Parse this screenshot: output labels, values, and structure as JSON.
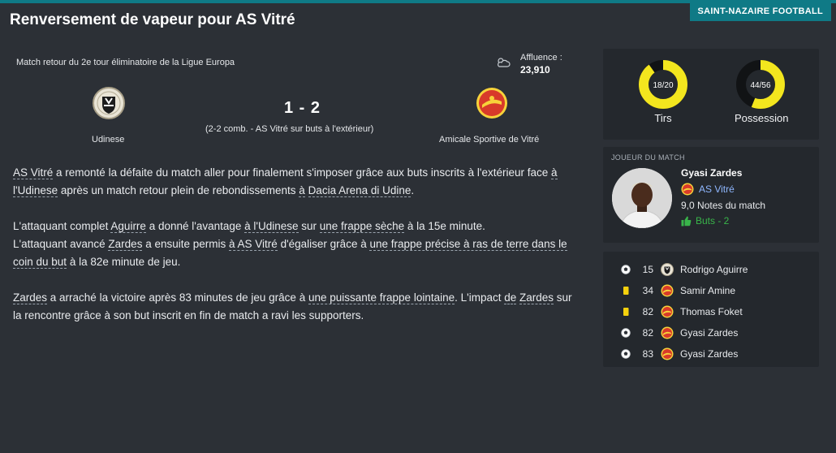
{
  "header": {
    "title": "Renversement de vapeur pour AS Vitré",
    "club_tag": "SAINT-NAZAIRE FOOTBALL"
  },
  "match": {
    "competition": "Match retour du 2e tour éliminatoire de la Ligue Europa",
    "weather_icon": "cloud-sun-icon",
    "attendance_label": "Affluence :",
    "attendance_value": "23,910",
    "home_team": "Udinese",
    "away_team": "Amicale Sportive de Vitré",
    "score": "1 - 2",
    "aggregate": "(2-2 comb. - AS Vitré sur buts à l'extérieur)"
  },
  "report": {
    "p1": [
      "AS Vitré",
      " a remonté la défaite du match aller pour finalement s'imposer grâce aux buts inscrits à l'extérieur face ",
      "à l'Udinese",
      " après un match retour plein de rebondissements ",
      "à",
      " ",
      "Dacia Arena di Udine",
      "."
    ],
    "p2": [
      "L'attaquant complet ",
      "Aguirre",
      " a donné l'avantage ",
      "à l'Udinese",
      " sur ",
      "une frappe sèche",
      " à la 15e minute."
    ],
    "p3": [
      "L'attaquant avancé ",
      "Zardes",
      " a ensuite permis ",
      "à AS Vitré",
      " d'égaliser grâce à ",
      "une frappe précise à ras de terre dans le coin du but",
      " à la 82e minute de jeu."
    ],
    "p4": [
      "Zardes",
      " a arraché la victoire après 83 minutes de jeu grâce à ",
      "une puissante frappe lointaine",
      ". L'impact ",
      "de",
      " ",
      "Zardes",
      " sur la rencontre grâce à son but inscrit en fin de match a ravi les supporters."
    ]
  },
  "stats": [
    {
      "label": "Tirs",
      "value_text": "18/20",
      "fraction": 0.9,
      "color": "#f3e61e"
    },
    {
      "label": "Possession",
      "value_text": "44/56",
      "fraction": 0.56,
      "color": "#f3e61e"
    }
  ],
  "potm": {
    "header": "JOUEUR DU MATCH",
    "name": "Gyasi Zardes",
    "club": "AS Vitré",
    "rating": "9,0",
    "rating_label": "Notes du match",
    "goals": "Buts - 2"
  },
  "events": [
    {
      "icon": "ball-icon",
      "minute": "15",
      "crest": "udinese",
      "player": "Rodrigo Aguirre"
    },
    {
      "icon": "yellow-card-icon",
      "minute": "34",
      "crest": "vitre",
      "player": "Samir Amine"
    },
    {
      "icon": "yellow-card-icon",
      "minute": "82",
      "crest": "vitre",
      "player": "Thomas Foket"
    },
    {
      "icon": "ball-icon",
      "minute": "82",
      "crest": "vitre",
      "player": "Gyasi Zardes"
    },
    {
      "icon": "ball-icon",
      "minute": "83",
      "crest": "vitre",
      "player": "Gyasi Zardes"
    }
  ],
  "colors": {
    "accent": "#0f7a86",
    "stat_fill": "#f3e61e",
    "link_blue": "#8fb7ff",
    "goal_green": "#39b54a"
  }
}
